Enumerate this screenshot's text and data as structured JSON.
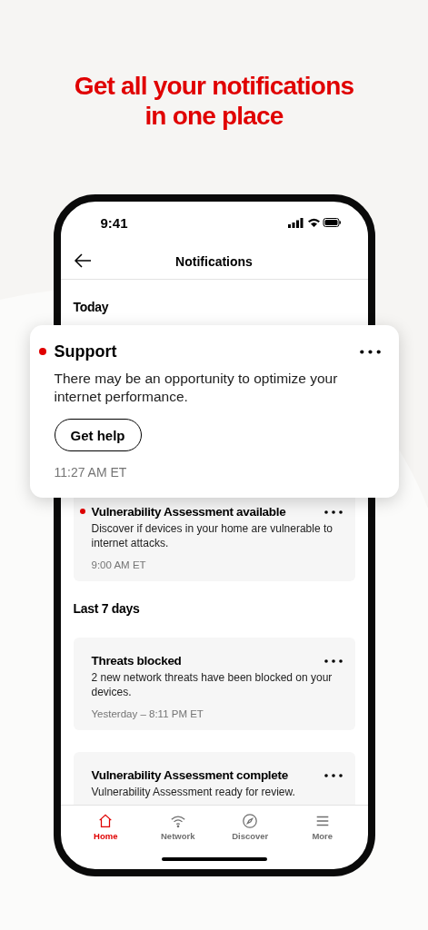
{
  "headline": "Get all your notifications in one place",
  "phone": {
    "status_bar": {
      "time": "9:41"
    },
    "header": {
      "title": "Notifications"
    },
    "sections": [
      {
        "title": "Today",
        "notifications": [
          {
            "title": "Vulnerability Assessment available",
            "body": "Discover if devices in your home are vulnerable to internet attacks.",
            "time": "9:00 AM ET",
            "unread": true
          }
        ]
      },
      {
        "title": "Last 7 days",
        "notifications": [
          {
            "title": "Threats blocked",
            "body": "2 new network threats have been blocked on your devices.",
            "time": "Yesterday – 8:11 PM ET",
            "unread": false
          },
          {
            "title": "Vulnerability Assessment complete",
            "body": "Vulnerability Assessment ready for review.",
            "unread": false
          }
        ]
      }
    ],
    "tabs": [
      {
        "label": "Home",
        "selected": true
      },
      {
        "label": "Network",
        "selected": false
      },
      {
        "label": "Discover",
        "selected": false
      },
      {
        "label": "More",
        "selected": false
      }
    ]
  },
  "popup": {
    "title": "Support",
    "unread": true,
    "body": "There may be an opportunity to optimize your internet performance.",
    "button": "Get help",
    "time": "11:27 AM ET"
  }
}
